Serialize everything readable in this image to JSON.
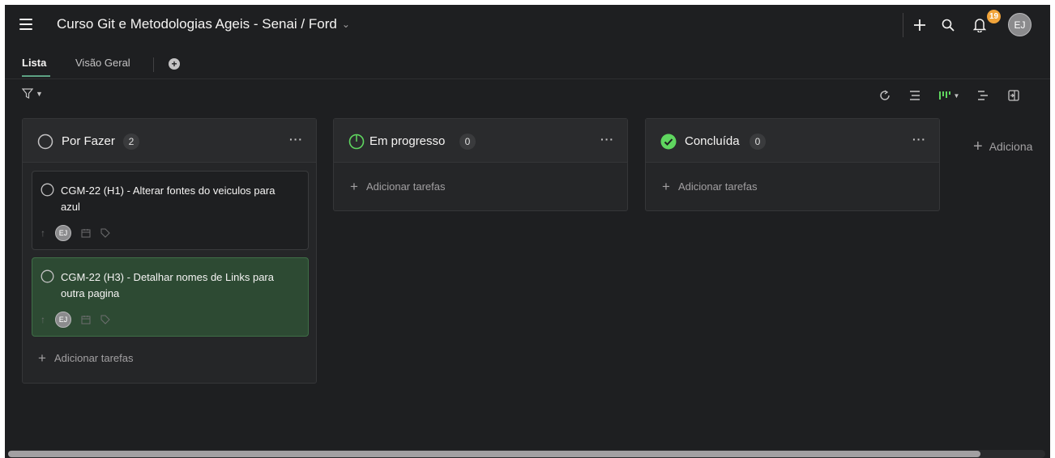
{
  "header": {
    "project_title": "Curso Git e Metodologias Ageis - Senai / Ford",
    "notification_count": "19",
    "user_initials": "EJ"
  },
  "tabs": [
    {
      "label": "Lista",
      "active": true
    },
    {
      "label": "Visão Geral",
      "active": false
    }
  ],
  "columns": [
    {
      "name": "Por Fazer",
      "count": "2",
      "status_icon": "circle-outline-icon"
    },
    {
      "name": "Em progresso",
      "count": "0",
      "status_icon": "progress-circle-icon"
    },
    {
      "name": "Concluída",
      "count": "0",
      "status_icon": "check-circle-icon"
    }
  ],
  "cards": [
    {
      "title": "CGM-22 (H1) - Alterar fontes do veiculos para azul",
      "assignee": "EJ"
    },
    {
      "title": "CGM-22 (H3) - Detalhar nomes de Links para outra pagina",
      "assignee": "EJ"
    }
  ],
  "add_task_label": "Adicionar tarefas",
  "add_section_label": "Adiciona",
  "colors": {
    "background": "#1e1f21",
    "accent_green": "#5fd65f",
    "selected_card": "#2d4a33",
    "badge_orange": "#f1a43a"
  }
}
